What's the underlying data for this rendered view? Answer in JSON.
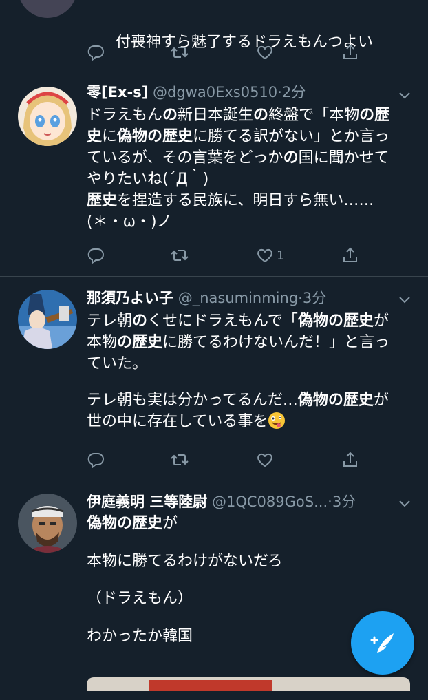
{
  "tweets": [
    {
      "partial_header": "",
      "body_lines": [
        "付喪神すら魅了するドラえもんつよい"
      ],
      "like_count": ""
    },
    {
      "name": "零[Ex-s]",
      "handle": "@dgwa0Exs0510",
      "dot": "·",
      "time": "2分",
      "body_html_parts": [
        [
          {
            "t": "ドラえもん"
          },
          {
            "t": "の",
            "b": true
          },
          {
            "t": "新日本誕生"
          },
          {
            "t": "の",
            "b": true
          },
          {
            "t": "終盤で「本物"
          },
          {
            "t": "の歴",
            "b": true
          }
        ],
        [
          {
            "t": "史",
            "b": true
          },
          {
            "t": "に"
          },
          {
            "t": "偽物の歴史",
            "b": true
          },
          {
            "t": "に勝てる訳がない」とか言っ"
          }
        ],
        [
          {
            "t": "ているが、その言葉をどっか"
          },
          {
            "t": "の",
            "b": true
          },
          {
            "t": "国に聞かせて"
          }
        ],
        [
          {
            "t": "やりたいね(´Д｀)"
          }
        ],
        [
          {
            "t": "歴史",
            "b": true
          },
          {
            "t": "を捏造する民族に、明日すら無い……"
          }
        ],
        [
          {
            "t": "(＊・ω・)ノ"
          }
        ]
      ],
      "like_count": "1"
    },
    {
      "name": "那須乃よい子",
      "handle": "@_nasuminming",
      "dot": "·",
      "time": "3分",
      "body_html_parts": [
        [
          {
            "t": "テレ朝"
          },
          {
            "t": "の",
            "b": true
          },
          {
            "t": "くせにドラえもんで「"
          },
          {
            "t": "偽物の歴史",
            "b": true
          },
          {
            "t": "が"
          }
        ],
        [
          {
            "t": "本物"
          },
          {
            "t": "の歴史",
            "b": true
          },
          {
            "t": "に勝てるわけないんだ！」と言っ"
          }
        ],
        [
          {
            "t": "ていた。"
          }
        ],
        [
          {
            "t": ""
          }
        ],
        [
          {
            "t": "テレ朝も実は分かってるんだ…"
          },
          {
            "t": "偽物の歴史",
            "b": true
          },
          {
            "t": "が"
          }
        ],
        [
          {
            "t": "世の中に存在している事を"
          }
        ]
      ],
      "emoji": "zany-face",
      "like_count": ""
    },
    {
      "name": "伊庭義明 三等陸尉",
      "handle": "@1QC089GoS...",
      "dot": "·",
      "time": "3分",
      "body_html_parts": [
        [
          {
            "t": "偽物の歴史",
            "b": true
          },
          {
            "t": "が"
          }
        ],
        [
          {
            "t": ""
          }
        ],
        [
          {
            "t": "本物に勝てるわけがないだろ"
          }
        ],
        [
          {
            "t": ""
          }
        ],
        [
          {
            "t": "（ドラえもん）"
          }
        ],
        [
          {
            "t": ""
          }
        ],
        [
          {
            "t": "わかったか韓国"
          }
        ]
      ]
    }
  ],
  "icons": {
    "reply": "reply-icon",
    "retweet": "retweet-icon",
    "like": "heart-icon",
    "share": "share-icon",
    "caret": "chevron-down-icon",
    "compose": "compose-tweet-icon"
  },
  "colors": {
    "background": "#15202b",
    "divider": "#38444d",
    "muted": "#8899a6",
    "accent": "#1da1f2"
  }
}
